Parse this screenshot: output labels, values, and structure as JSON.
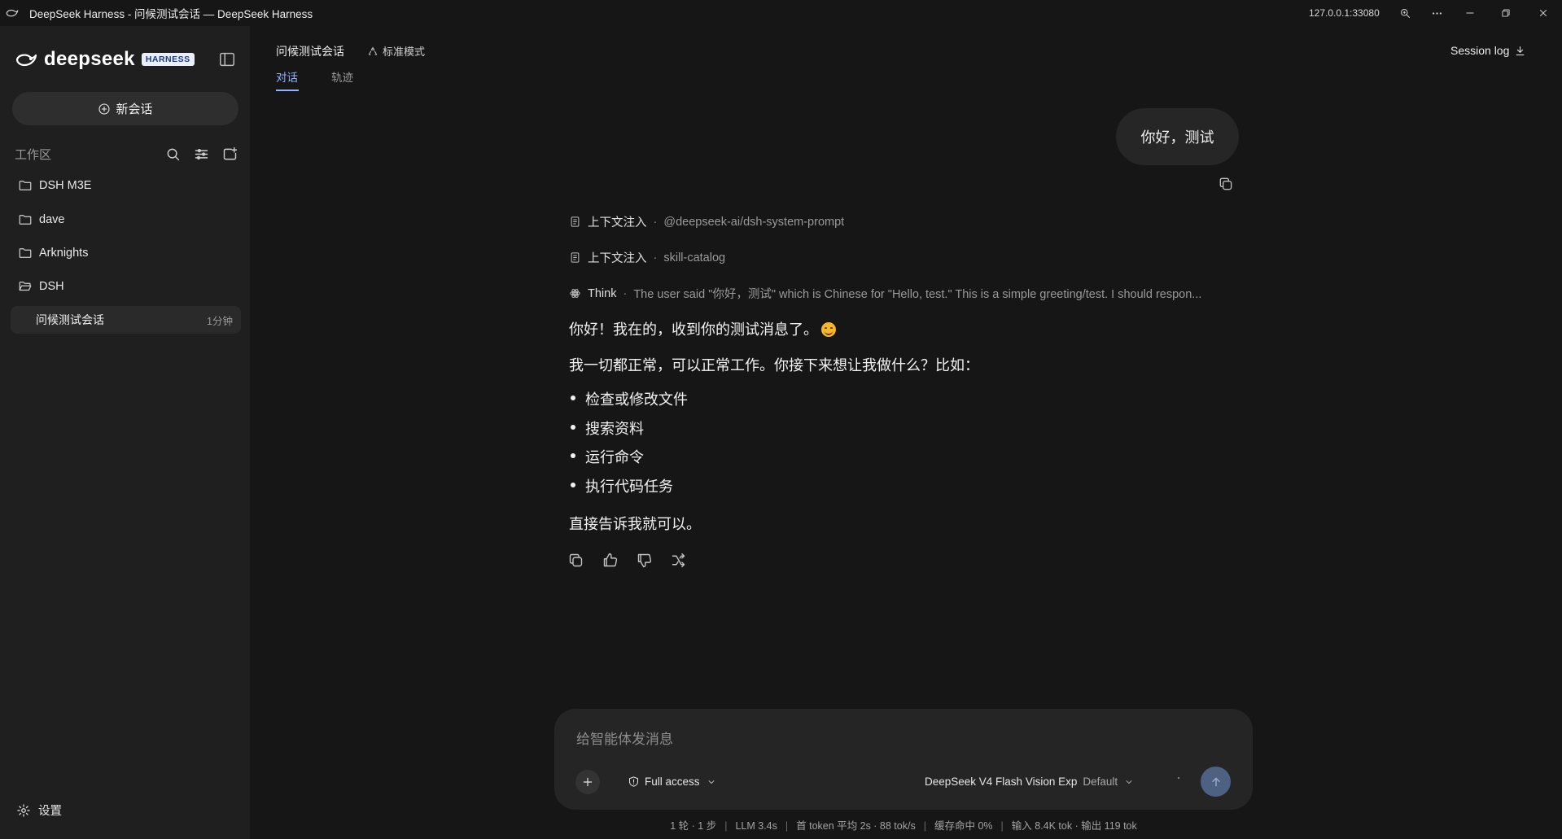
{
  "window": {
    "title": "DeepSeek Harness - 问候测试会话 — DeepSeek Harness",
    "address": "127.0.0.1:33080"
  },
  "sidebar": {
    "brand_name": "deepseek",
    "brand_badge": "HARNESS",
    "new_chat_label": "新会话",
    "workspace_label": "工作区",
    "folders": [
      {
        "label": "DSH M3E",
        "icon": "folder-icon"
      },
      {
        "label": "dave",
        "icon": "folder-icon"
      },
      {
        "label": "Arknights",
        "icon": "folder-icon"
      },
      {
        "label": "DSH",
        "icon": "folder-open-icon"
      }
    ],
    "sessions": [
      {
        "title": "问候测试会话",
        "time": "1分钟"
      }
    ],
    "settings_label": "设置"
  },
  "header": {
    "title": "问候测试会话",
    "mode": "标准模式",
    "tabs": [
      {
        "label": "对话",
        "active": true
      },
      {
        "label": "轨迹",
        "active": false
      }
    ],
    "session_log": "Session log"
  },
  "conversation": {
    "user_message": "你好，测试",
    "meta": [
      {
        "label": "上下文注入",
        "value": "@deepseek-ai/dsh-system-prompt"
      },
      {
        "label": "上下文注入",
        "value": "skill-catalog"
      },
      {
        "label": "Think",
        "value": "The user said \"你好，测试\" which is Chinese for \"Hello, test.\" This is a simple greeting/test. I should respon..."
      }
    ],
    "answer": {
      "p1": "你好！我在的，收到你的测试消息了。",
      "p2": "我一切都正常，可以正常工作。你接下来想让我做什么？比如：",
      "bullets": [
        "检查或修改文件",
        "搜索资料",
        "运行命令",
        "执行代码任务"
      ],
      "p3": "直接告诉我就可以。"
    }
  },
  "composer": {
    "placeholder": "给智能体发消息",
    "access": "Full access",
    "model": "DeepSeek V4 Flash Vision Exp",
    "model_variant": "Default"
  },
  "stats": [
    "1 轮 · 1 步",
    "LLM 3.4s",
    "首 token 平均 2s · 88 tok/s",
    "缓存命中 0%",
    "输入 8.4K tok · 输出 119 tok"
  ],
  "colors": {
    "background": "#161616",
    "sidebar": "#1f1f1f",
    "accent": "#8fb3ff",
    "send_button": "#4d6283"
  }
}
